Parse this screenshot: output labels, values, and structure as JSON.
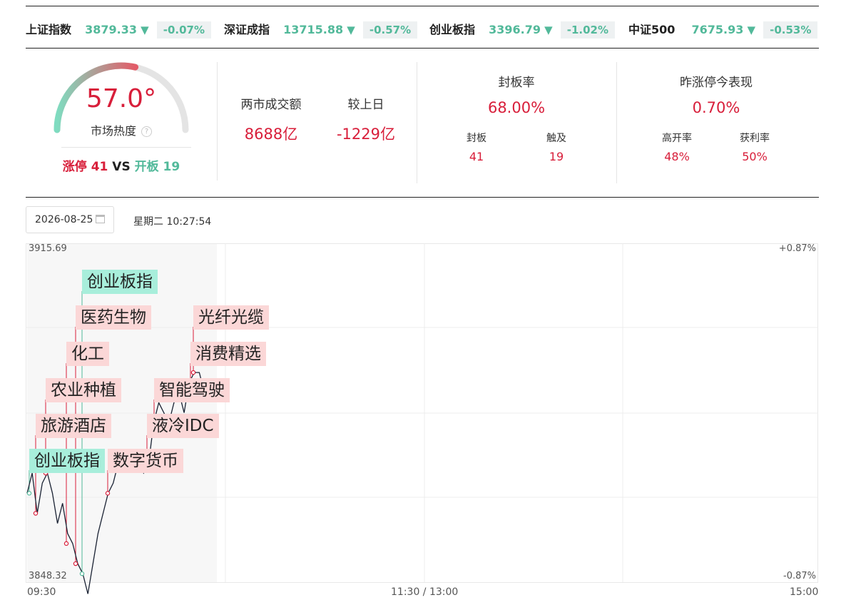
{
  "indices": [
    {
      "name": "上证指数",
      "value": "3879.33",
      "arrow": "▼",
      "change": "-0.07%"
    },
    {
      "name": "深证成指",
      "value": "13715.88",
      "arrow": "▼",
      "change": "-0.57%"
    },
    {
      "name": "创业板指",
      "value": "3396.79",
      "arrow": "▼",
      "change": "-1.02%"
    },
    {
      "name": "中证500",
      "value": "7675.93",
      "arrow": "▼",
      "change": "-0.53%"
    }
  ],
  "heat": {
    "value": "57.0°",
    "label": "市场热度",
    "help": "?",
    "gauge_fraction": 0.57,
    "limit_up_label": "涨停",
    "limit_up_count": "41",
    "vs": "VS",
    "broken_label": "开板",
    "broken_count": "19"
  },
  "turnover": {
    "label": "两市成交额",
    "value": "8688亿",
    "cmp_label": "较上日",
    "cmp_value": "-1229亿"
  },
  "seal": {
    "title": "封板率",
    "value": "68.00%",
    "a_label": "封板",
    "a_value": "41",
    "b_label": "触及",
    "b_value": "19"
  },
  "yesterday": {
    "title": "昨涨停今表现",
    "value": "0.70%",
    "a_label": "高开率",
    "a_value": "48%",
    "b_label": "获利率",
    "b_value": "50%"
  },
  "date": {
    "value": "2026-08-25",
    "weekday_time": "星期二 10:27:54"
  },
  "chart_data": {
    "type": "line",
    "y_max": "3915.69",
    "y_min": "3848.32",
    "ymax_pct": "+0.87%",
    "ymin_pct": "-0.87%",
    "x_ticks": [
      "09:30",
      "11:30 / 13:00",
      "15:00"
    ],
    "series": [
      {
        "values": [
          3866,
          3870,
          3862,
          3868,
          3870,
          3866,
          3860,
          3864,
          3858,
          3856,
          3852,
          3850,
          3846,
          3852,
          3858,
          3862,
          3866,
          3868,
          3872,
          3874,
          3872,
          3874,
          3872,
          3870,
          3872,
          3880,
          3884,
          3882,
          3880,
          3884,
          3886,
          3882,
          3888,
          3890,
          3890,
          3886
        ]
      }
    ],
    "tags": [
      {
        "text": "创业板指",
        "color": "green"
      },
      {
        "text": "医药生物",
        "color": "red"
      },
      {
        "text": "化工",
        "color": "red"
      },
      {
        "text": "农业种植",
        "color": "red"
      },
      {
        "text": "旅游酒店",
        "color": "red"
      },
      {
        "text": "创业板指",
        "color": "green"
      },
      {
        "text": "数字货币",
        "color": "red"
      },
      {
        "text": "液冷IDC",
        "color": "red"
      },
      {
        "text": "智能驾驶",
        "color": "red"
      },
      {
        "text": "消费精选",
        "color": "red"
      },
      {
        "text": "光纤光缆",
        "color": "red"
      }
    ]
  }
}
